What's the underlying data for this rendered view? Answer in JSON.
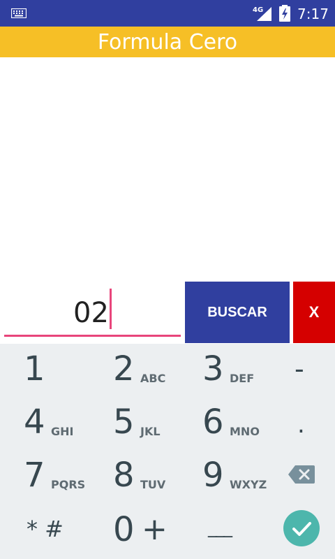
{
  "status_bar": {
    "time": "7:17",
    "network": "4G"
  },
  "app_bar": {
    "title": "Formula Cero"
  },
  "input": {
    "value": "02"
  },
  "buttons": {
    "search_label": "BUSCAR",
    "close_label": "X"
  },
  "keypad": {
    "keys": [
      {
        "digit": "1",
        "letters": ""
      },
      {
        "digit": "2",
        "letters": "ABC"
      },
      {
        "digit": "3",
        "letters": "DEF"
      },
      {
        "digit": "4",
        "letters": "GHI"
      },
      {
        "digit": "5",
        "letters": "JKL"
      },
      {
        "digit": "6",
        "letters": "MNO"
      },
      {
        "digit": "7",
        "letters": "PQRS"
      },
      {
        "digit": "8",
        "letters": "TUV"
      },
      {
        "digit": "9",
        "letters": "WXYZ"
      }
    ],
    "side_keys": {
      "minus": "-",
      "dot": ".",
      "star_hash": "* #",
      "zero": "0",
      "plus": "+",
      "space": "___"
    }
  },
  "icons": [
    "keyboard-icon",
    "signal-icon",
    "battery-charging-icon",
    "backspace-icon",
    "check-icon"
  ],
  "colors": {
    "status_bar": "#303f9f",
    "app_bar": "#f6bf26",
    "search_button": "#303f9f",
    "close_button": "#d50000",
    "accent": "#e8457b",
    "keypad_bg": "#eceff1",
    "done_button": "#4db6ac"
  }
}
